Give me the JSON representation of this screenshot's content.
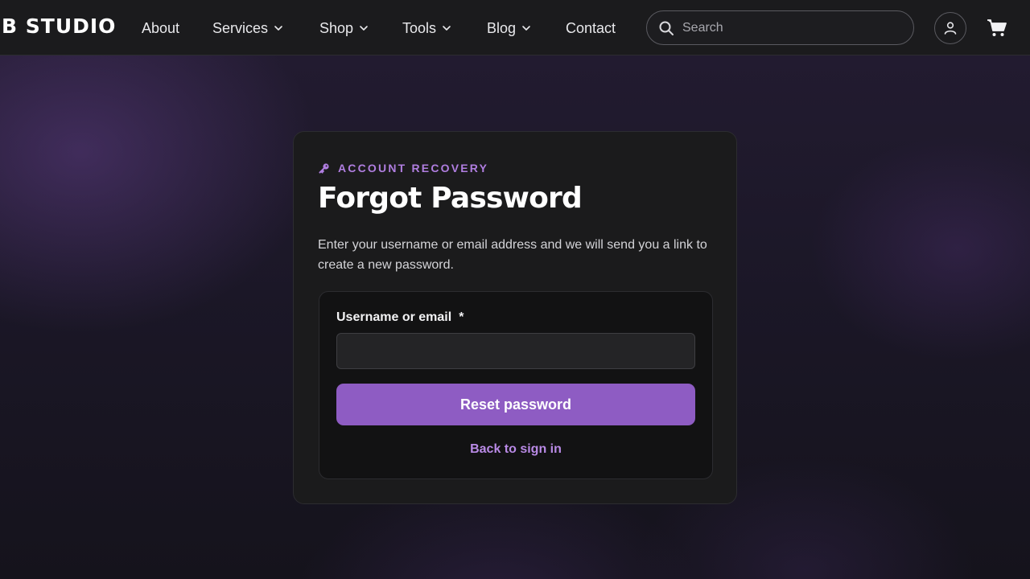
{
  "brand": {
    "name": "B STUDIO"
  },
  "nav": {
    "items": [
      {
        "label": "About",
        "has_dropdown": false
      },
      {
        "label": "Services",
        "has_dropdown": true
      },
      {
        "label": "Shop",
        "has_dropdown": true
      },
      {
        "label": "Tools",
        "has_dropdown": true
      },
      {
        "label": "Blog",
        "has_dropdown": true
      },
      {
        "label": "Contact",
        "has_dropdown": false
      }
    ],
    "search_placeholder": "Search",
    "icons": [
      "search-icon",
      "user-icon",
      "cart-icon",
      "chevron-down-icon"
    ]
  },
  "recovery": {
    "eyebrow": "ACCOUNT RECOVERY",
    "eyebrow_icon": "key-icon",
    "title": "Forgot Password",
    "description": "Enter your username or email address and we will send you a link to create a new password.",
    "field_label": "Username or email",
    "required_mark": "*",
    "field_value": "",
    "submit_label": "Reset password",
    "back_link": "Back to sign in"
  },
  "colors": {
    "accent": "#8e5cc3",
    "accent_text": "#b07ee0",
    "navbar_bg": "#1b1b1d",
    "card_bg": "#1b1b1c",
    "panel_bg": "#121213"
  }
}
